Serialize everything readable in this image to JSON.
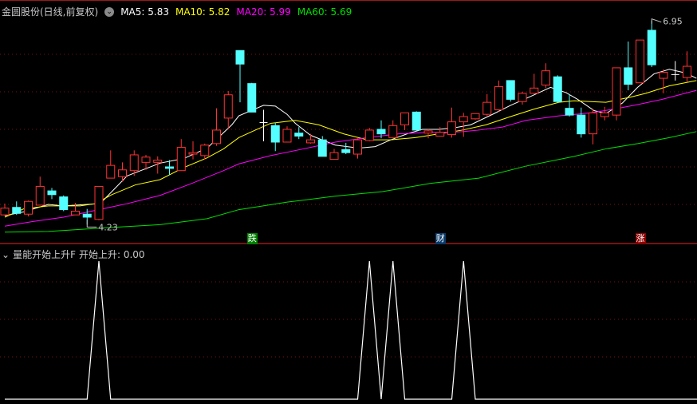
{
  "header": {
    "title": "金圆股份(日线,前复权)",
    "ma5": "MA5: 5.83",
    "ma10": "MA10: 5.82",
    "ma20": "MA20: 5.99",
    "ma60": "MA60: 5.69",
    "colors": {
      "ma5": "#ffffff",
      "ma10": "#ffff00",
      "ma20": "#ff00ff",
      "ma60": "#00e000",
      "up": "#ff3232",
      "down": "#54ffff"
    }
  },
  "markers": [
    {
      "label": "跌",
      "index": 21,
      "color": "#008000"
    },
    {
      "label": "财",
      "index": 37,
      "color": "#0a3a6a"
    },
    {
      "label": "涨",
      "index": 54,
      "color": "#8b0000"
    }
  ],
  "annotations": {
    "low_label": "4.23",
    "high_label": "6.95",
    "low_index": 7,
    "high_index": 55
  },
  "indicator": {
    "title": "量能开始上升F",
    "value_label": "开始上升: 0.00",
    "signal_indices": [
      8,
      31,
      33,
      39
    ]
  },
  "chart_data": {
    "type": "candlestick",
    "price_range": [
      4.1,
      7.0
    ],
    "candles_ohlc": [
      [
        4.36,
        4.51,
        4.35,
        4.45
      ],
      [
        4.46,
        4.54,
        4.36,
        4.38
      ],
      [
        4.37,
        4.55,
        4.34,
        4.54
      ],
      [
        4.49,
        4.87,
        4.49,
        4.74
      ],
      [
        4.68,
        4.72,
        4.57,
        4.63
      ],
      [
        4.6,
        4.62,
        4.41,
        4.43
      ],
      [
        4.36,
        4.52,
        4.36,
        4.41
      ],
      [
        4.37,
        4.44,
        4.23,
        4.33
      ],
      [
        4.3,
        4.74,
        4.29,
        4.74
      ],
      [
        4.85,
        5.22,
        4.85,
        5.02
      ],
      [
        4.87,
        5.06,
        4.8,
        4.96
      ],
      [
        4.95,
        5.22,
        4.88,
        5.16
      ],
      [
        5.06,
        5.16,
        4.96,
        5.13
      ],
      [
        5.06,
        5.14,
        4.91,
        5.09
      ],
      [
        5.0,
        5.09,
        4.89,
        4.98
      ],
      [
        4.95,
        5.37,
        4.95,
        5.26
      ],
      [
        5.17,
        5.34,
        5.1,
        5.19
      ],
      [
        5.15,
        5.31,
        5.1,
        5.29
      ],
      [
        5.31,
        5.78,
        5.28,
        5.49
      ],
      [
        5.65,
        6.01,
        5.5,
        5.96
      ],
      [
        6.55,
        6.55,
        5.86,
        6.37
      ],
      [
        6.11,
        6.12,
        5.73,
        5.73
      ],
      [
        5.59,
        5.76,
        5.34,
        5.59
      ],
      [
        5.55,
        5.59,
        5.21,
        5.33
      ],
      [
        5.33,
        5.54,
        5.33,
        5.5
      ],
      [
        5.45,
        5.53,
        5.37,
        5.41
      ],
      [
        5.32,
        5.44,
        5.31,
        5.36
      ],
      [
        5.36,
        5.41,
        5.14,
        5.14
      ],
      [
        5.1,
        5.24,
        5.1,
        5.19
      ],
      [
        5.23,
        5.32,
        5.17,
        5.19
      ],
      [
        5.17,
        5.38,
        5.11,
        5.36
      ],
      [
        5.35,
        5.52,
        5.34,
        5.49
      ],
      [
        5.5,
        5.62,
        5.38,
        5.44
      ],
      [
        5.39,
        5.62,
        5.39,
        5.55
      ],
      [
        5.56,
        5.72,
        5.49,
        5.72
      ],
      [
        5.73,
        5.74,
        5.49,
        5.49
      ],
      [
        5.45,
        5.51,
        5.38,
        5.48
      ],
      [
        5.41,
        5.53,
        5.41,
        5.46
      ],
      [
        5.43,
        5.79,
        5.39,
        5.6
      ],
      [
        5.6,
        5.72,
        5.4,
        5.67
      ],
      [
        5.64,
        5.71,
        5.63,
        5.71
      ],
      [
        5.7,
        5.97,
        5.68,
        5.86
      ],
      [
        5.76,
        6.15,
        5.74,
        6.07
      ],
      [
        6.15,
        6.15,
        5.87,
        5.9
      ],
      [
        5.87,
        6.0,
        5.83,
        5.98
      ],
      [
        5.98,
        6.24,
        5.97,
        6.05
      ],
      [
        6.09,
        6.38,
        6.05,
        6.28
      ],
      [
        6.2,
        6.22,
        5.85,
        5.87
      ],
      [
        5.78,
        5.97,
        5.67,
        5.69
      ],
      [
        5.69,
        5.79,
        5.39,
        5.44
      ],
      [
        5.44,
        5.77,
        5.3,
        5.72
      ],
      [
        5.67,
        5.8,
        5.62,
        5.72
      ],
      [
        5.69,
        6.32,
        5.62,
        6.32
      ],
      [
        6.32,
        6.67,
        6.02,
        6.1
      ],
      [
        6.12,
        6.69,
        6.12,
        6.69
      ],
      [
        6.82,
        6.95,
        6.33,
        6.36
      ],
      [
        6.18,
        6.3,
        5.98,
        6.26
      ],
      [
        6.23,
        6.41,
        6.15,
        6.23
      ],
      [
        6.19,
        6.54,
        6.13,
        6.34
      ]
    ],
    "ma_series": [
      {
        "name": "MA5",
        "color": "#ffffff",
        "points": [
          [
            0,
            4.35
          ],
          [
            1.6,
            4.4
          ],
          [
            3.7,
            4.5
          ],
          [
            5,
            4.48
          ],
          [
            7,
            4.5
          ],
          [
            8.1,
            4.51
          ],
          [
            9.1,
            4.67
          ],
          [
            10.4,
            4.88
          ],
          [
            13.2,
            5.05
          ],
          [
            15.2,
            5.11
          ],
          [
            17.2,
            5.25
          ],
          [
            19.3,
            5.56
          ],
          [
            19.9,
            5.68
          ],
          [
            22,
            5.82
          ],
          [
            23,
            5.81
          ],
          [
            24,
            5.7
          ],
          [
            24.7,
            5.58
          ],
          [
            26,
            5.42
          ],
          [
            28.1,
            5.29
          ],
          [
            30.1,
            5.25
          ],
          [
            31.5,
            5.27
          ],
          [
            32.8,
            5.36
          ],
          [
            34.2,
            5.44
          ],
          [
            35.5,
            5.5
          ],
          [
            36.9,
            5.5
          ],
          [
            38.2,
            5.52
          ],
          [
            39.6,
            5.56
          ],
          [
            41.6,
            5.71
          ],
          [
            43,
            5.82
          ],
          [
            44.3,
            5.91
          ],
          [
            46.4,
            6.06
          ],
          [
            47.7,
            5.99
          ],
          [
            48.7,
            5.9
          ],
          [
            50.1,
            5.75
          ],
          [
            51.1,
            5.71
          ],
          [
            52.5,
            5.85
          ],
          [
            53.8,
            6.06
          ],
          [
            55.2,
            6.24
          ],
          [
            56.5,
            6.3
          ],
          [
            57.9,
            6.25
          ],
          [
            58.8,
            6.18
          ]
        ]
      },
      {
        "name": "MA10",
        "color": "#ffff00",
        "points": [
          [
            0,
            4.33
          ],
          [
            1.6,
            4.44
          ],
          [
            3.7,
            4.48
          ],
          [
            6.4,
            4.48
          ],
          [
            7.7,
            4.51
          ],
          [
            9.1,
            4.63
          ],
          [
            11.1,
            4.76
          ],
          [
            13.2,
            4.83
          ],
          [
            15.2,
            4.99
          ],
          [
            17.2,
            5.12
          ],
          [
            18.6,
            5.24
          ],
          [
            19.9,
            5.39
          ],
          [
            21.3,
            5.49
          ],
          [
            22.6,
            5.58
          ],
          [
            24.7,
            5.62
          ],
          [
            26.7,
            5.56
          ],
          [
            28.8,
            5.44
          ],
          [
            30.8,
            5.36
          ],
          [
            32.8,
            5.36
          ],
          [
            34.9,
            5.39
          ],
          [
            36.9,
            5.44
          ],
          [
            38.9,
            5.49
          ],
          [
            40.9,
            5.56
          ],
          [
            43,
            5.67
          ],
          [
            45,
            5.77
          ],
          [
            47.1,
            5.86
          ],
          [
            48.4,
            5.88
          ],
          [
            49.8,
            5.87
          ],
          [
            51.1,
            5.86
          ],
          [
            53.2,
            5.93
          ],
          [
            54.5,
            5.98
          ],
          [
            56.5,
            6.08
          ],
          [
            58.8,
            6.15
          ]
        ]
      },
      {
        "name": "MA20",
        "color": "#ff00ff",
        "points": [
          [
            0,
            4.21
          ],
          [
            2.3,
            4.27
          ],
          [
            5,
            4.33
          ],
          [
            7.7,
            4.42
          ],
          [
            10.4,
            4.51
          ],
          [
            13.2,
            4.62
          ],
          [
            15.9,
            4.78
          ],
          [
            18.6,
            4.95
          ],
          [
            19.9,
            5.04
          ],
          [
            22.6,
            5.15
          ],
          [
            25.4,
            5.24
          ],
          [
            28.1,
            5.33
          ],
          [
            30.8,
            5.39
          ],
          [
            33.5,
            5.44
          ],
          [
            36.2,
            5.46
          ],
          [
            37.6,
            5.46
          ],
          [
            38.9,
            5.47
          ],
          [
            40.3,
            5.49
          ],
          [
            42.3,
            5.53
          ],
          [
            44.3,
            5.62
          ],
          [
            47.1,
            5.68
          ],
          [
            49.8,
            5.72
          ],
          [
            51.8,
            5.77
          ],
          [
            53.8,
            5.83
          ],
          [
            55.9,
            5.9
          ],
          [
            58.8,
            6.02
          ]
        ]
      },
      {
        "name": "MA60",
        "color": "#00e000",
        "points": [
          [
            0,
            4.13
          ],
          [
            3.7,
            4.14
          ],
          [
            7.7,
            4.18
          ],
          [
            13.2,
            4.23
          ],
          [
            17.2,
            4.31
          ],
          [
            19.9,
            4.43
          ],
          [
            24,
            4.53
          ],
          [
            28.1,
            4.61
          ],
          [
            32.1,
            4.67
          ],
          [
            36.2,
            4.78
          ],
          [
            40.3,
            4.85
          ],
          [
            44.3,
            5.01
          ],
          [
            48.4,
            5.14
          ],
          [
            51.1,
            5.24
          ],
          [
            53.8,
            5.31
          ],
          [
            56.5,
            5.39
          ],
          [
            58.8,
            5.47
          ]
        ]
      }
    ],
    "gridlines": [
      4.5,
      5.0,
      5.5,
      6.0,
      6.5
    ]
  }
}
